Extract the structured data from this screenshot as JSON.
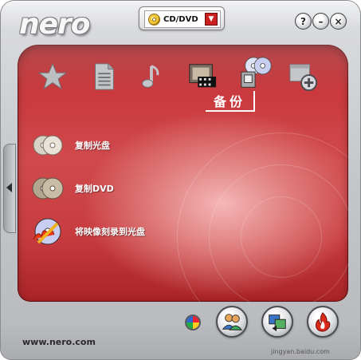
{
  "app": {
    "logo_text": "nero",
    "selector_label": "CD/DVD",
    "window_buttons": [
      "?",
      "–",
      "×"
    ]
  },
  "categories": {
    "icons": [
      "favorites-star-icon",
      "data-document-icon",
      "music-note-icon",
      "video-film-icon",
      "backup-discs-icon",
      "extras-add-icon"
    ],
    "active_label": "备份"
  },
  "tasks": [
    {
      "label": "复制光盘",
      "icon": "copy-disc-icon"
    },
    {
      "label": "复制DVD",
      "icon": "copy-dvd-icon"
    },
    {
      "label": "将映像刻录到光盘",
      "icon": "burn-image-icon"
    }
  ],
  "footer": {
    "url": "www.nero.com",
    "watermark": "jingyan.baidu.com"
  },
  "colors": {
    "panel_red": "#c9383c",
    "frame_silver": "#c4c6ca"
  }
}
